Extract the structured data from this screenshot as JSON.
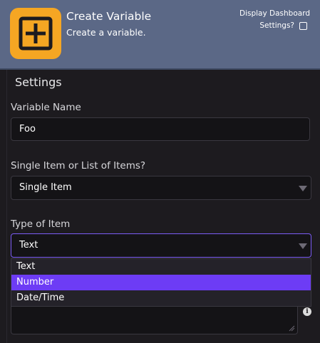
{
  "header": {
    "title": "Create Variable",
    "description": "Create a variable.",
    "dashboard_label_line1": "Display Dashboard",
    "dashboard_label_line2": "Settings?",
    "dashboard_checked": false,
    "logo_icon": "plus-square-icon",
    "colors": {
      "header_bg": "#5b6886",
      "logo_bg": "#f5a623"
    }
  },
  "settings": {
    "title": "Settings",
    "variable_name": {
      "label": "Variable Name",
      "value": "Foo"
    },
    "item_mode": {
      "label": "Single Item or List of Items?",
      "selected": "Single Item"
    },
    "item_type": {
      "label": "Type of Item",
      "selected": "Text",
      "options": [
        "Text",
        "Number",
        "Date/Time"
      ],
      "highlighted": "Number"
    }
  },
  "colors": {
    "background": "#1d1b1f",
    "accent": "#7b5cf5",
    "highlight": "#6d3cf5"
  }
}
